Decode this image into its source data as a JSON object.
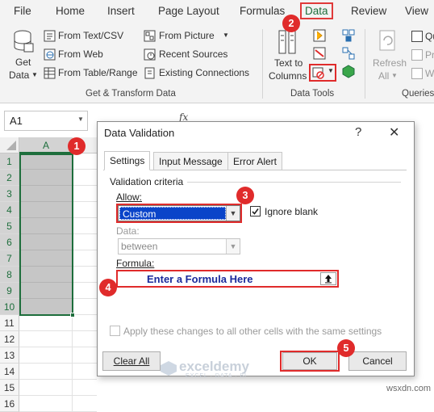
{
  "tabs": [
    "File",
    "Home",
    "Insert",
    "Page Layout",
    "Formulas",
    "Data",
    "Review",
    "View"
  ],
  "active_tab": "Data",
  "ribbon": {
    "get_data": "Get",
    "get_data_2": "Data",
    "from_text_csv": "From Text/CSV",
    "from_web": "From Web",
    "from_table_range": "From Table/Range",
    "from_picture": "From Picture",
    "recent_sources": "Recent Sources",
    "existing_connections": "Existing Connections",
    "group_get_transform": "Get & Transform Data",
    "text_to": "Text to",
    "columns": "Columns",
    "group_data_tools": "Data Tools",
    "refresh": "Refresh",
    "all": "All",
    "group_queries": "Queries",
    "qu": "Qu",
    "pr": "Pr",
    "w": "W"
  },
  "formula_bar": {
    "name_box": "A1",
    "fx": "fx"
  },
  "grid": {
    "column_a": "A",
    "rows": [
      "1",
      "2",
      "3",
      "4",
      "5",
      "6",
      "7",
      "8",
      "9",
      "10",
      "11",
      "12",
      "13",
      "14",
      "15",
      "16"
    ]
  },
  "badges": [
    "1",
    "2",
    "3",
    "4",
    "5"
  ],
  "dialog": {
    "title": "Data Validation",
    "help": "?",
    "close": "✕",
    "tabs": [
      "Settings",
      "Input Message",
      "Error Alert"
    ],
    "validation_criteria": "Validation criteria",
    "allow_label": "Allow:",
    "allow_value": "Custom",
    "ignore_blank": "Ignore blank",
    "data_label": "Data:",
    "data_value": "between",
    "formula_label": "Formula:",
    "formula_value": "Enter a Formula Here",
    "apply_all": "Apply these changes to all other cells with the same settings",
    "clear_all": "Clear All",
    "ok": "OK",
    "cancel": "Cancel"
  },
  "watermark": {
    "name": "exceldemy",
    "tagline": "EXCEL · DATA · BI",
    "site": "wsxdn.com"
  },
  "colors": {
    "accent_red": "#e02b2b",
    "excel_green": "#1e6e3c",
    "selection_blue": "#0a44c9",
    "formula_text": "#1a2a9c"
  }
}
